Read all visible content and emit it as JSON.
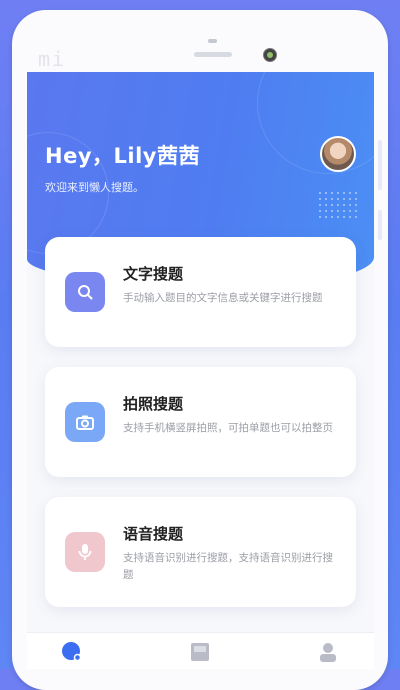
{
  "device": {
    "brand": "mi"
  },
  "header": {
    "title": "Hey，Lily茜茜",
    "subtitle": "欢迎来到懒人搜题。"
  },
  "cards": [
    {
      "title": "文字搜题",
      "desc": "手动输入题目的文字信息或关键字进行搜题",
      "icon": "search-icon",
      "color": "#7b87f1"
    },
    {
      "title": "拍照搜题",
      "desc": "支持手机横竖屏拍照，可拍单题也可以拍整页",
      "icon": "camera-icon",
      "color": "#7aa8f6"
    },
    {
      "title": "语音搜题",
      "desc": "支持语音识别进行搜题，支持语音识别进行搜题",
      "icon": "microphone-icon",
      "color": "#f1c7ce"
    }
  ],
  "tabs": [
    {
      "icon": "home-search-icon",
      "active": true
    },
    {
      "icon": "book-icon",
      "active": false
    },
    {
      "icon": "profile-icon",
      "active": false
    }
  ],
  "colors": {
    "primary": "#5a7cf2",
    "tab_active": "#3b6ef0",
    "tab_inactive": "#b9bcc6"
  }
}
